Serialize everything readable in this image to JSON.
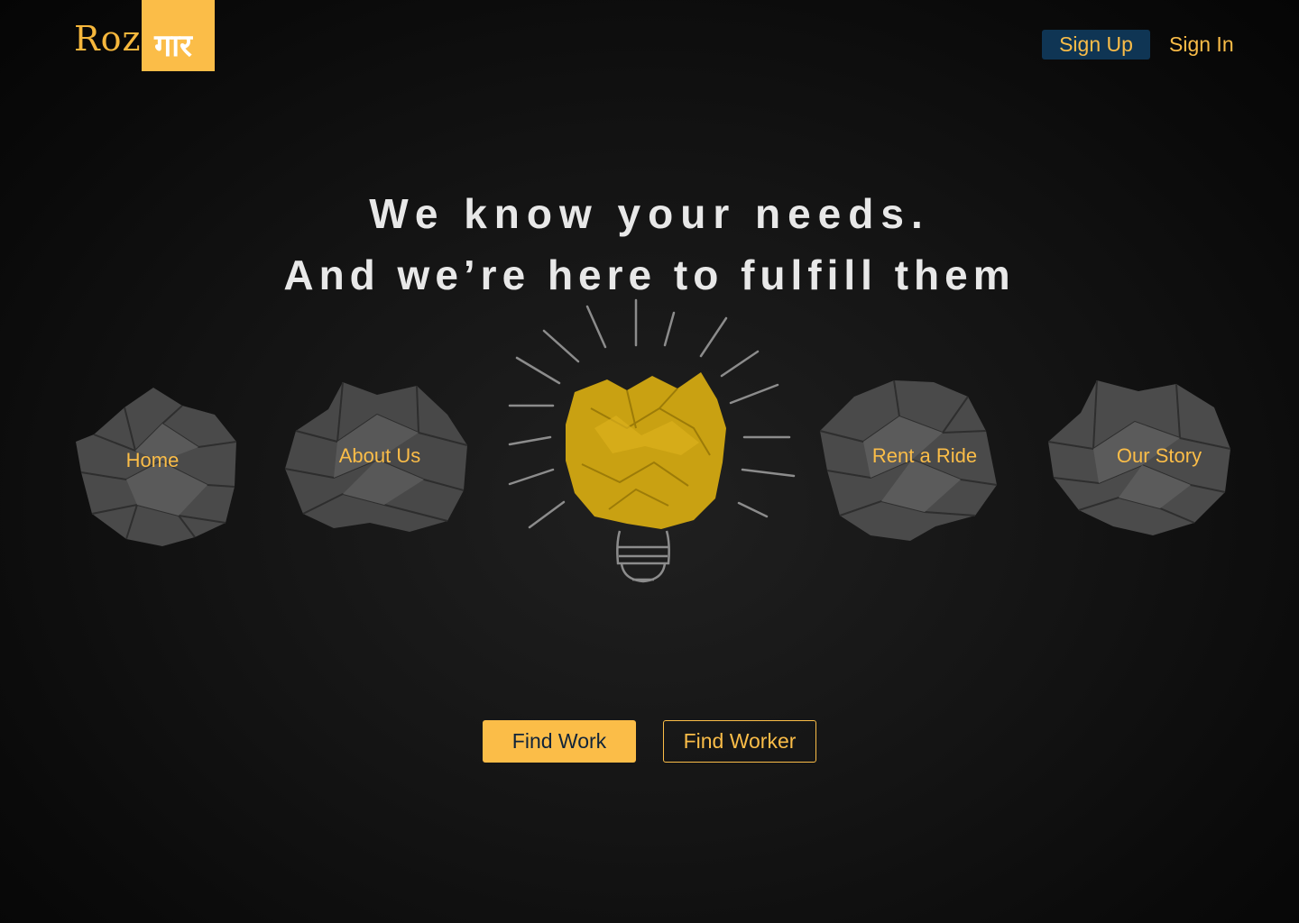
{
  "brand": {
    "logo_left": "Roz",
    "logo_right": "गार",
    "accent": "#fbbd48"
  },
  "auth": {
    "signup_label": "Sign Up",
    "signin_label": "Sign In"
  },
  "hero": {
    "line1": "We know your needs.",
    "line2": "And we’re here to fulfill them"
  },
  "nav": [
    {
      "label": "Home"
    },
    {
      "label": "About Us"
    },
    {
      "label": "Rent a Ride"
    },
    {
      "label": "Our Story"
    }
  ],
  "actions": {
    "find_work_label": "Find Work",
    "find_worker_label": "Find Worker"
  }
}
